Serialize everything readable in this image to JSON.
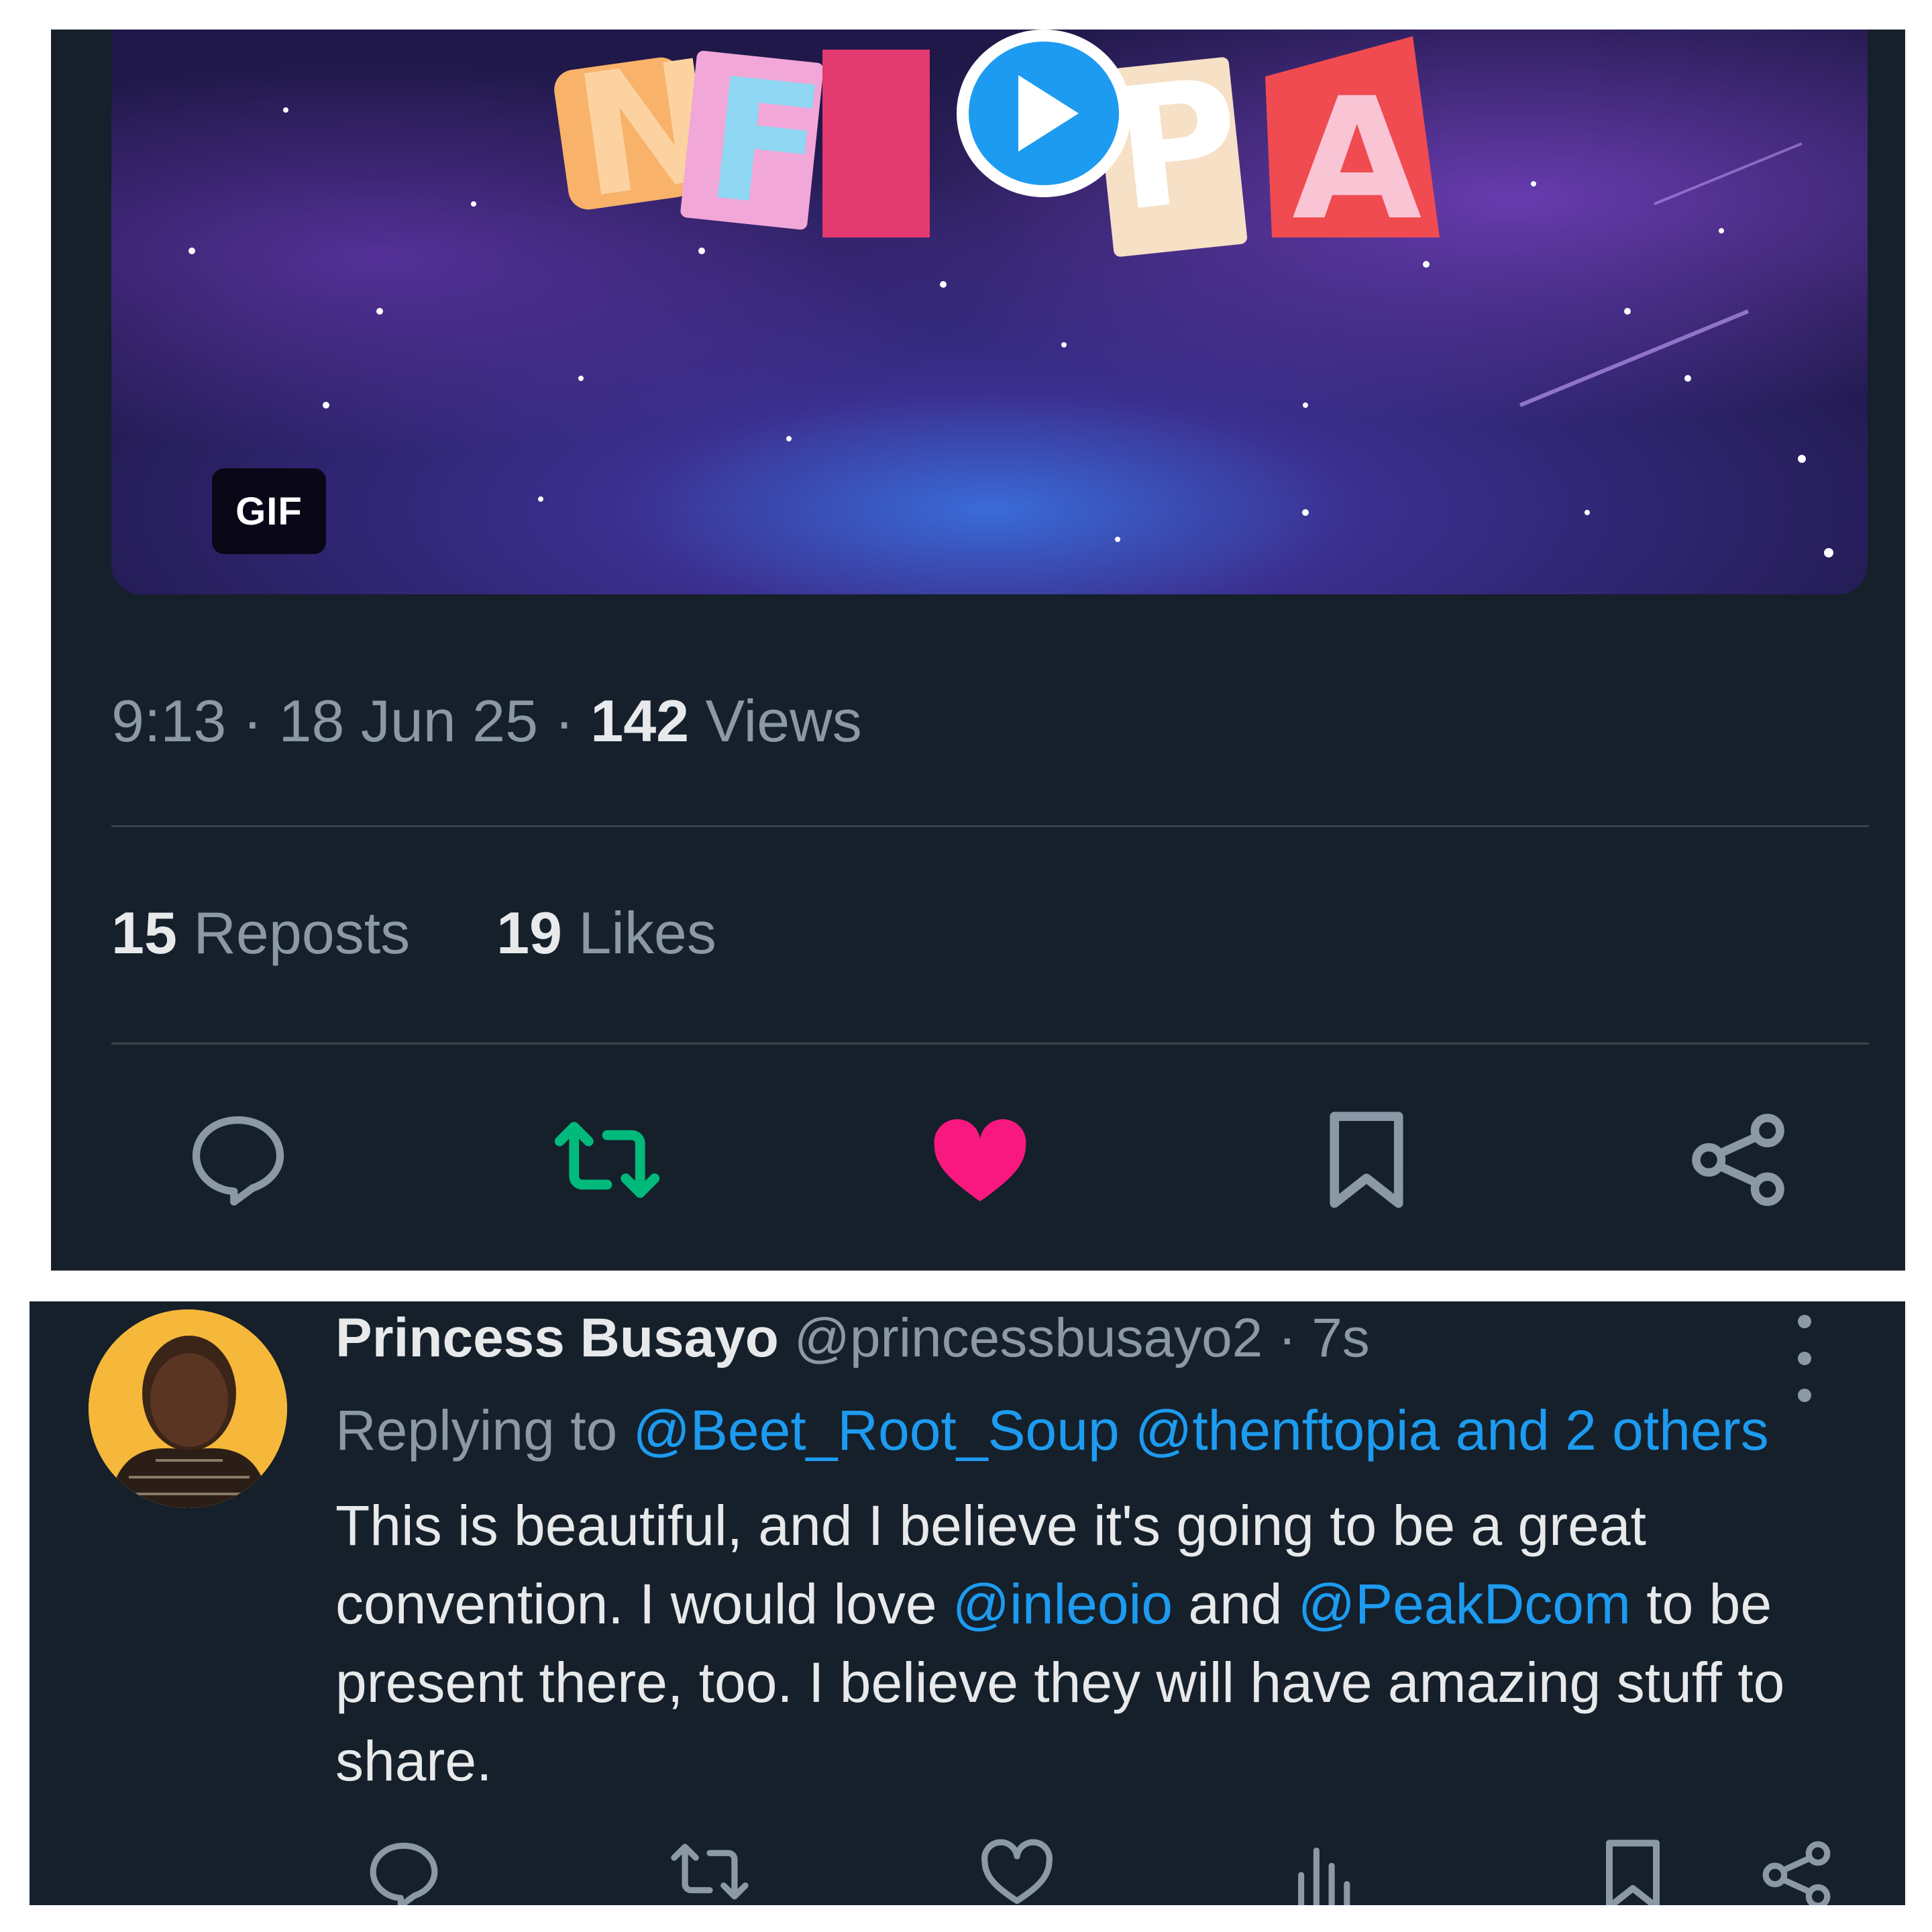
{
  "post": {
    "media_badge": "GIF",
    "logo_text": "NFTOPIA",
    "time": "9:13",
    "date": "18 Jun 25",
    "views_count": "142",
    "views_label": "Views",
    "reposts_count": "15",
    "reposts_label": "Reposts",
    "likes_count": "19",
    "likes_label": "Likes",
    "actions": [
      "reply-icon",
      "repost-icon",
      "like-icon",
      "bookmark-icon",
      "share-icon"
    ],
    "liked": true,
    "reposted": true
  },
  "reply": {
    "name": "Princess Busayo",
    "handle": "@princessbusayo2",
    "age": "7s",
    "replying_label": "Replying to",
    "replying_mentions": "@Beet_Root_Soup @thenftopia and 2 others",
    "text_part1": "This is beautiful, and I believe it's going to be a great convention. I would love ",
    "mention1": "@inleoio",
    "text_part2": " and ",
    "mention2": "@PeakDcom",
    "text_part3": "  to be present there, too. I believe they will have amazing stuff to share.",
    "actions": [
      "reply-icon",
      "repost-icon",
      "like-icon",
      "views-icon",
      "bookmark-icon",
      "share-icon"
    ]
  },
  "colors": {
    "background": "#15202b",
    "text_primary": "#e7e9ea",
    "text_secondary": "#8b98a5",
    "link": "#1d9bf0",
    "repost_active": "#00ba7c",
    "like_active": "#f91880",
    "divider": "#38444d"
  }
}
